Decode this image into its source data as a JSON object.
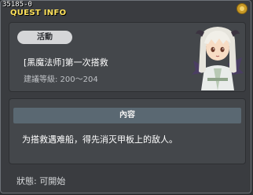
{
  "window": {
    "quest_id": "35185-0",
    "title": "QUEST INFO"
  },
  "quest": {
    "category": "活動",
    "name": "[黑魔法师]第一次搭救",
    "level_requirement": "建議等級: 200～204",
    "npc_icon": "silver-haired-demon-girl-npc-portrait"
  },
  "content": {
    "header": "內容",
    "text": "为搭救遇难船，得先消灭甲板上的敌人。"
  },
  "status": {
    "text": "狀態: 可開始"
  },
  "colors": {
    "title": "#ffe25a",
    "panel": "#44474b",
    "header_bar": "#5a6872"
  }
}
